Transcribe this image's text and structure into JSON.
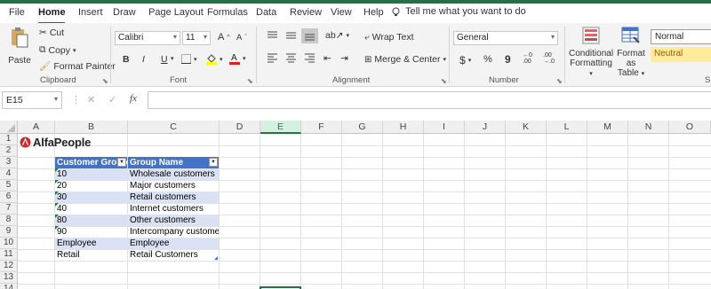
{
  "ribbon_tabs": [
    "File",
    "Home",
    "Insert",
    "Draw",
    "Page Layout",
    "Formulas",
    "Data",
    "Review",
    "View",
    "Help"
  ],
  "tell_me": "Tell me what you want to do",
  "clipboard": {
    "paste": "Paste",
    "cut": "Cut",
    "copy": "Copy",
    "format_painter": "Format Painter",
    "label": "Clipboard"
  },
  "font": {
    "name": "Calibri",
    "size": "11",
    "bold": "B",
    "italic": "I",
    "underline": "U",
    "label": "Font",
    "grow": "A",
    "shrink": "A"
  },
  "alignment": {
    "wrap": "Wrap Text",
    "merge": "Merge & Center",
    "label": "Alignment"
  },
  "number": {
    "format": "General",
    "currency": "$",
    "percent": "%",
    "comma": "9",
    "label": "Number"
  },
  "styles": {
    "conditional": "Conditional",
    "conditional2": "Formatting",
    "format_as": "Format as",
    "table": "Table",
    "normal": "Normal",
    "neutral": "Neutral",
    "s": "S"
  },
  "formula_bar": {
    "name_box": "E15",
    "fx": "fx",
    "cancel": "✕",
    "enter": "✓"
  },
  "columns": [
    "A",
    "B",
    "C",
    "D",
    "E",
    "F",
    "G",
    "H",
    "I",
    "J",
    "K",
    "L",
    "M",
    "N",
    "O"
  ],
  "selected_column": "E",
  "rows": [
    "1",
    "2",
    "3",
    "4",
    "5",
    "6",
    "7",
    "8",
    "9",
    "10",
    "11",
    "12",
    "13",
    "14"
  ],
  "logo": "AlfaPeople",
  "table": {
    "headers": [
      "Customer Group",
      "Group Name"
    ],
    "rows": [
      [
        "10",
        "Wholesale customers"
      ],
      [
        "20",
        "Major customers"
      ],
      [
        "30",
        "Retail customers"
      ],
      [
        "40",
        "Internet customers"
      ],
      [
        "80",
        "Other customers"
      ],
      [
        "90",
        "Intercompany customers"
      ],
      [
        "Employee",
        "Employee"
      ],
      [
        "Retail",
        "Retail Customers"
      ]
    ]
  },
  "colors": {
    "excel_green": "#217346",
    "table_header": "#4472c4",
    "table_band": "#d9e1f2",
    "neutral": "#ffeb9c"
  }
}
